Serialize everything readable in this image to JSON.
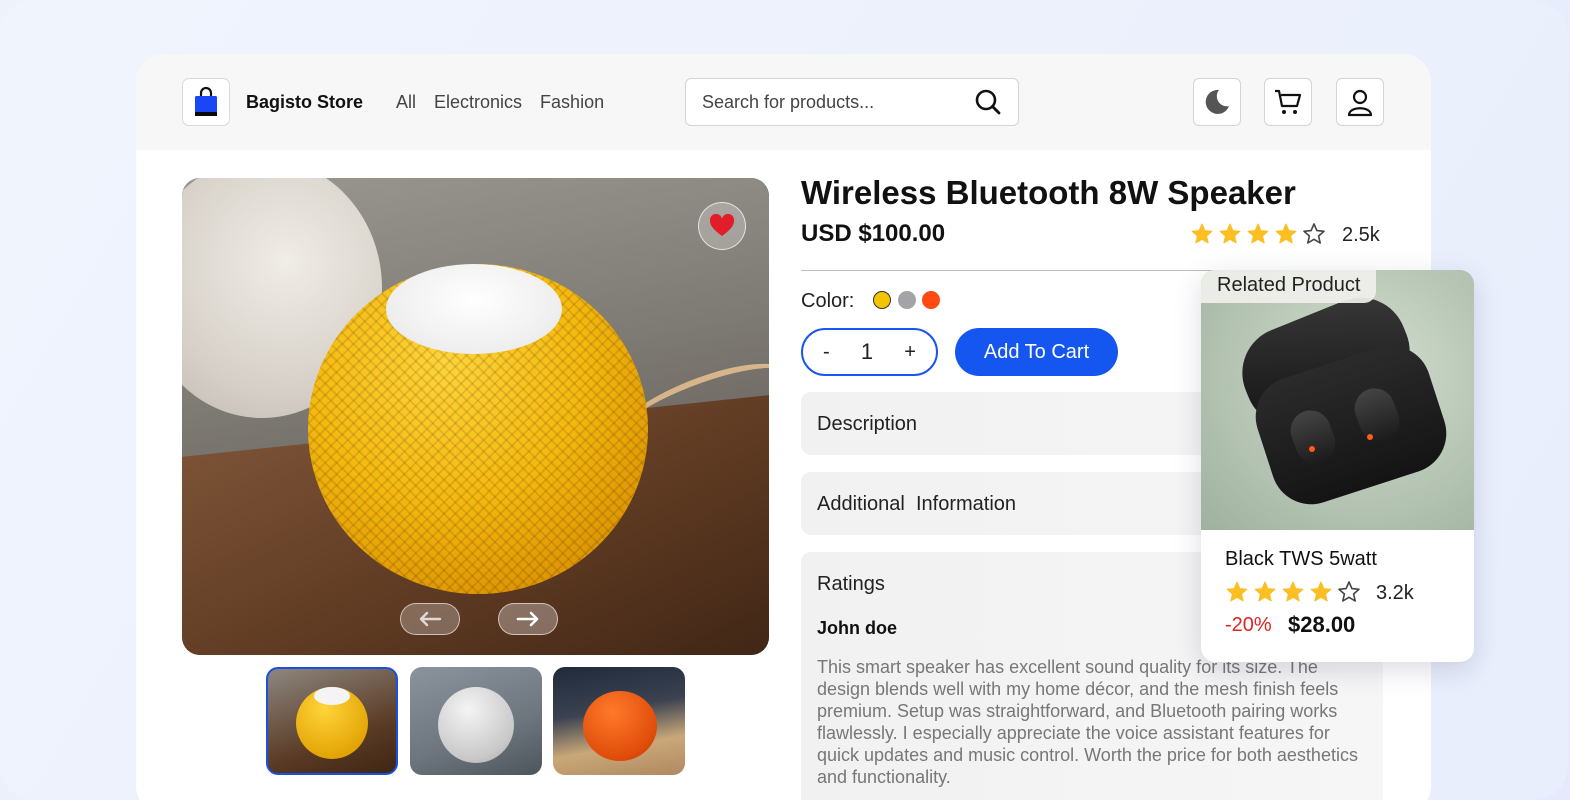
{
  "header": {
    "store_name": "Bagisto Store",
    "nav": [
      "All",
      "Electronics",
      "Fashion"
    ],
    "search_placeholder": "Search for products..."
  },
  "product": {
    "title": "Wireless Bluetooth 8W Speaker",
    "price": "USD $100.00",
    "rating_stars": 4,
    "rating_count": "2.5k",
    "color_label": "Color:",
    "colors": [
      "#f5c400",
      "#a3a3a8",
      "#ff4a12"
    ],
    "quantity_minus": "-",
    "quantity": "1",
    "quantity_plus": "+",
    "add_to_cart": "Add To Cart"
  },
  "accordions": {
    "description": "Description",
    "additional": "Additional  Information",
    "ratings": "Ratings"
  },
  "review": {
    "author": "John doe",
    "text": "This smart speaker has excellent sound quality for its size. The design blends well with my home décor, and the mesh finish feels premium. Setup was straightforward, and Bluetooth pairing works flawlessly. I especially appreciate the voice assistant features for quick updates and music control. Worth the price for both aesthetics and functionality."
  },
  "related": {
    "tag": "Related Product",
    "name": "Black TWS 5watt",
    "rating_stars": 4,
    "rating_count": "3.2k",
    "discount": "-20%",
    "price": "$28.00"
  },
  "colors": {
    "accent": "#1656f0",
    "star": "#fbbf24",
    "heart": "#e11d2a",
    "discount": "#e02424"
  },
  "icons": {
    "logo": "shopping-bag-icon",
    "search": "search-icon",
    "theme": "moon-icon",
    "cart": "cart-icon",
    "account": "user-icon",
    "wishlist": "heart-icon",
    "prev": "arrow-left-icon",
    "next": "arrow-right-icon"
  }
}
